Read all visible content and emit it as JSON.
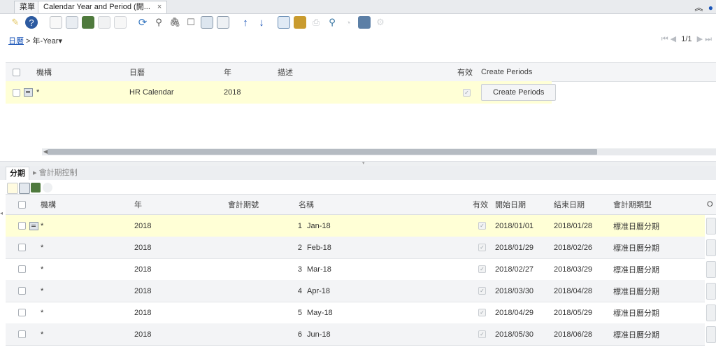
{
  "tabs": {
    "menu_label": "菜單",
    "active_label": "Calendar Year and Period (開...",
    "close": "×",
    "collapse": "≈",
    "help": "◐"
  },
  "breadcrumb": {
    "link": "日曆",
    "sep": " > ",
    "current": "年-Year",
    "dropdown": "▾"
  },
  "navigation": {
    "first": "⏮",
    "prev": "◀",
    "position": "1/1",
    "next": "▶",
    "last": "⏭"
  },
  "year_grid": {
    "headers": [
      "機構",
      "日曆",
      "年",
      "描述",
      "有效",
      "Create Periods"
    ],
    "rows": [
      {
        "org": "*",
        "calendar": "HR Calendar",
        "year": "2018",
        "description": "",
        "active": "✓",
        "button": "Create Periods"
      }
    ]
  },
  "subtabs": {
    "active": "分期",
    "inactive": "會計期控制",
    "arrow": "▸"
  },
  "period_grid": {
    "headers": [
      "機構",
      "年",
      "會計期號",
      "名稱",
      "有效",
      "開始日期",
      "結束日期",
      "會計期類型",
      "O"
    ],
    "rows": [
      {
        "org": "*",
        "year": "2018",
        "no": "1",
        "name": "Jan-18",
        "active": "✓",
        "start": "2018/01/01",
        "end": "2018/01/28",
        "type": "標准日曆分期"
      },
      {
        "org": "*",
        "year": "2018",
        "no": "2",
        "name": "Feb-18",
        "active": "✓",
        "start": "2018/01/29",
        "end": "2018/02/26",
        "type": "標准日曆分期"
      },
      {
        "org": "*",
        "year": "2018",
        "no": "3",
        "name": "Mar-18",
        "active": "✓",
        "start": "2018/02/27",
        "end": "2018/03/29",
        "type": "標准日曆分期"
      },
      {
        "org": "*",
        "year": "2018",
        "no": "4",
        "name": "Apr-18",
        "active": "✓",
        "start": "2018/03/30",
        "end": "2018/04/28",
        "type": "標准日曆分期"
      },
      {
        "org": "*",
        "year": "2018",
        "no": "5",
        "name": "May-18",
        "active": "✓",
        "start": "2018/04/29",
        "end": "2018/05/29",
        "type": "標准日曆分期"
      },
      {
        "org": "*",
        "year": "2018",
        "no": "6",
        "name": "Jun-18",
        "active": "✓",
        "start": "2018/05/30",
        "end": "2018/06/28",
        "type": "標准日曆分期"
      }
    ]
  },
  "colors": {
    "selected_row": "#ffffd6",
    "link": "#1a55b8",
    "nav_arrow": "#1a55b8"
  }
}
